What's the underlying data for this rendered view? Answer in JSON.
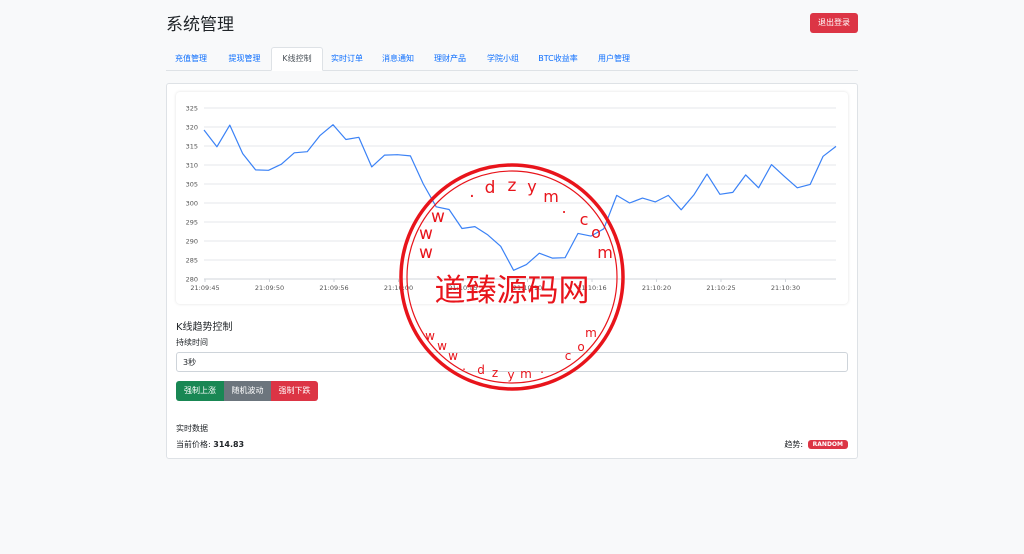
{
  "header": {
    "title": "系统管理",
    "logout_label": "退出登录"
  },
  "tabs": [
    {
      "label": "充值管理",
      "active": false
    },
    {
      "label": "提现管理",
      "active": false
    },
    {
      "label": "K线控制",
      "active": true
    },
    {
      "label": "实时订单",
      "active": false
    },
    {
      "label": "消息通知",
      "active": false
    },
    {
      "label": "理财产品",
      "active": false
    },
    {
      "label": "学院小组",
      "active": false
    },
    {
      "label": "BTC收益率",
      "active": false
    },
    {
      "label": "用户管理",
      "active": false
    }
  ],
  "chart_data": {
    "type": "line",
    "ylim": [
      280,
      325
    ],
    "y_ticks": [
      280,
      285,
      290,
      295,
      300,
      305,
      310,
      315,
      320,
      325
    ],
    "x_tick_labels": [
      "21:09:45",
      "21:09:50",
      "21:09:56",
      "21:10:00",
      "21:10:05",
      "21:10:10",
      "21:10:16",
      "21:10:20",
      "21:10:25",
      "21:10:30"
    ],
    "grid": true,
    "series": [
      {
        "color": "#3b82f6",
        "values": [
          319.2,
          314.8,
          320.5,
          313.0,
          308.7,
          308.6,
          310.2,
          313.2,
          313.5,
          317.8,
          320.6,
          316.7,
          317.3,
          309.5,
          312.6,
          312.7,
          312.4,
          305.0,
          299.0,
          298.3,
          293.3,
          293.8,
          291.6,
          288.6,
          282.3,
          283.8,
          286.8,
          285.5,
          285.6,
          292.0,
          291.3,
          293.2,
          302.0,
          300.0,
          301.3,
          300.3,
          302.0,
          298.2,
          302.2,
          307.6,
          302.3,
          302.8,
          307.4,
          304.0,
          310.1,
          307.0,
          304.0,
          304.9,
          312.3,
          314.9
        ]
      }
    ]
  },
  "control": {
    "heading": "K线趋势控制",
    "duration_label": "持续时间",
    "duration_value": "3秒",
    "buttons": {
      "up": "强制上涨",
      "random": "随机波动",
      "down": "强制下跌"
    }
  },
  "realtime": {
    "label": "实时数据",
    "price_label": "当前价格:",
    "price_value": "314.83",
    "trend_label": "趋势:",
    "trend_value": "RANDOM"
  },
  "watermark": {
    "text": "道臻源码网",
    "url": "www.dzym.com",
    "color": "#e8141b"
  }
}
